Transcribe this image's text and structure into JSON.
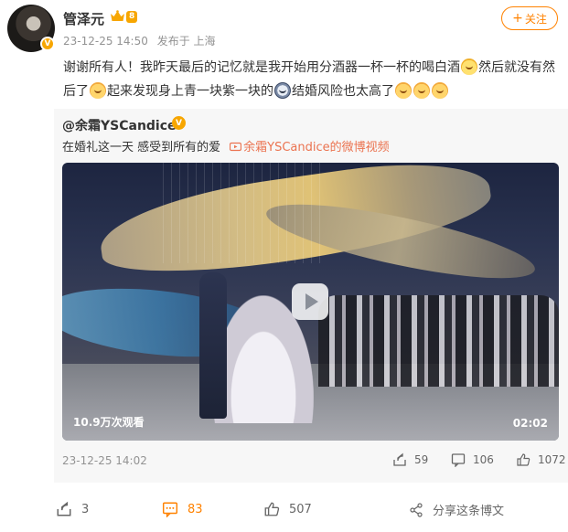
{
  "header": {
    "username": "管泽元",
    "level_badge": "8",
    "avatar_badge": "V",
    "timestamp": "23-12-25 14:50",
    "source": "发布于 上海",
    "follow_label": "关注"
  },
  "post": {
    "text_1": "谢谢所有人！我昨天最后的记忆就是我开始用分酒器一杯一杯的喝白酒",
    "text_2": "然后就没有然后了",
    "text_3": "起来发现身上青一块紫一块的",
    "text_4": "结婚风险也太高了"
  },
  "retweet": {
    "author": "@余霜YSCandice",
    "verified_badge": "V",
    "text": "在婚礼这一天 感受到所有的爱",
    "video_link": "余霜YSCandice的微博视频",
    "video": {
      "views": "10.9万次观看",
      "duration": "02:02"
    },
    "timestamp": "23-12-25 14:02",
    "reposts": "59",
    "comments": "106",
    "likes": "1072"
  },
  "toolbar": {
    "reposts": "3",
    "comments": "83",
    "likes": "507",
    "share_label": "分享这条博文"
  },
  "colors": {
    "accent": "#ff8200",
    "link": "#eb7350",
    "meta_gray": "#939393",
    "retweet_bg": "#f7f7f7"
  }
}
